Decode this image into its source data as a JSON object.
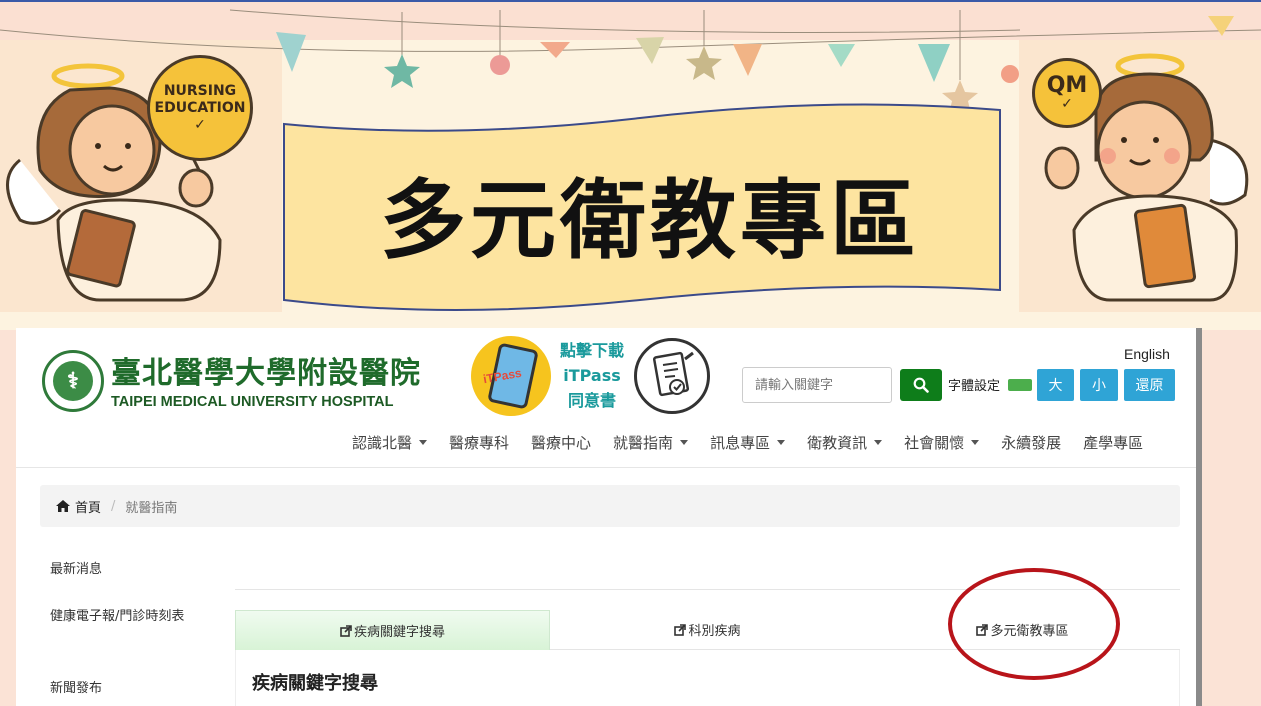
{
  "banner": {
    "title": "多元衛教專區",
    "badge_left_line1": "NURSING",
    "badge_left_line2": "EDUCATION",
    "badge_right": "QM"
  },
  "header": {
    "logo_cn": "臺北醫學大學附設醫院",
    "logo_en": "TAIPEI MEDICAL UNIVERSITY HOSPITAL",
    "itpass_label": "iTPass",
    "itpass_line1": "點擊下載",
    "itpass_line2": "iTPass",
    "itpass_line3": "同意書",
    "search_placeholder": "請輸入關鍵字",
    "font_setting_label": "字體設定",
    "font_large": "大",
    "font_small": "小",
    "font_reset": "還原",
    "english": "English"
  },
  "nav": [
    {
      "label": "認識北醫",
      "dropdown": true
    },
    {
      "label": "醫療專科",
      "dropdown": false
    },
    {
      "label": "醫療中心",
      "dropdown": false
    },
    {
      "label": "就醫指南",
      "dropdown": true
    },
    {
      "label": "訊息專區",
      "dropdown": true
    },
    {
      "label": "衛教資訊",
      "dropdown": true
    },
    {
      "label": "社會關懷",
      "dropdown": true
    },
    {
      "label": "永續發展",
      "dropdown": false
    },
    {
      "label": "產學專區",
      "dropdown": false
    }
  ],
  "breadcrumb": {
    "home": "首頁",
    "separator": "/",
    "current": "就醫指南"
  },
  "sidebar": {
    "items": [
      "最新消息",
      "健康電子報/門診時刻表",
      "新聞發布"
    ]
  },
  "tabs": [
    {
      "label": "疾病關鍵字搜尋",
      "active": true
    },
    {
      "label": "科別疾病",
      "active": false
    },
    {
      "label": "多元衛教專區",
      "active": false
    }
  ],
  "panel": {
    "title": "疾病關鍵字搜尋"
  },
  "colors": {
    "hospital_green": "#1f6b2b",
    "search_button": "#0e7d1a",
    "font_button": "#2fa4d6",
    "highlight_circle": "#b8141a",
    "banner_ribbon": "#fde4a0"
  }
}
